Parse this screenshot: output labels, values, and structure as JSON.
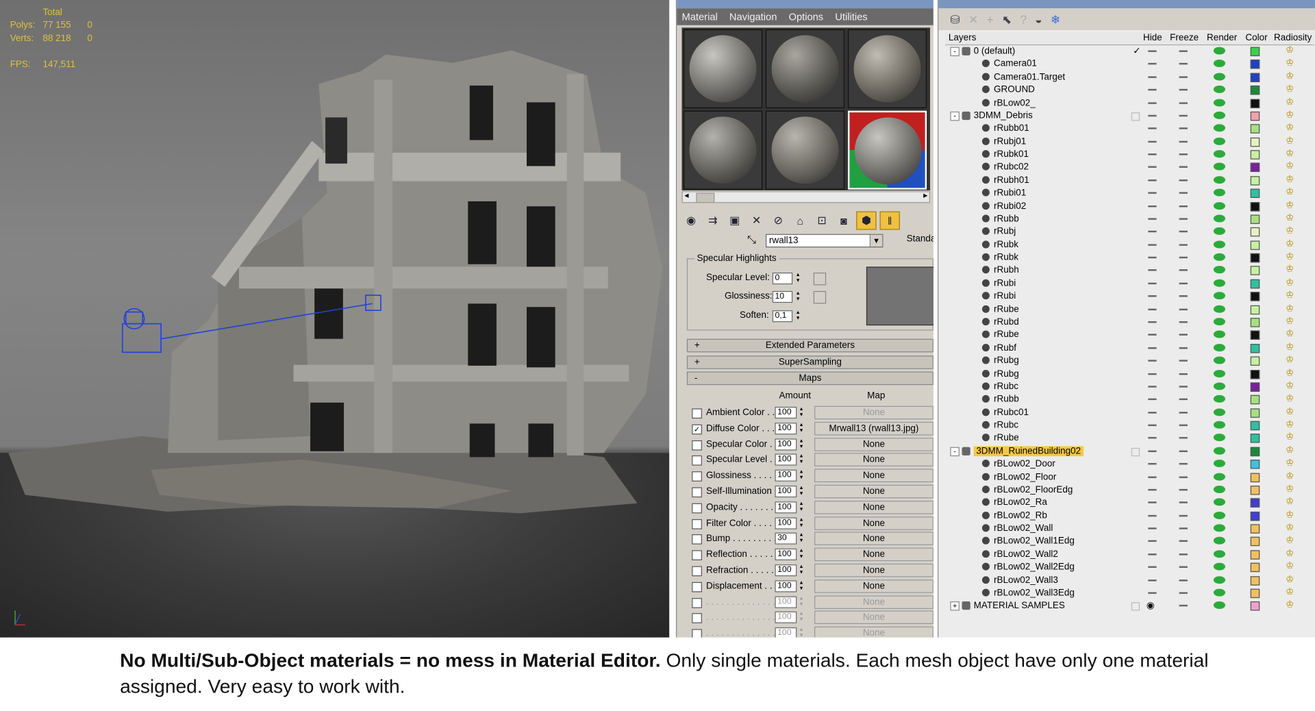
{
  "viewport": {
    "stats": {
      "total_label": "Total",
      "polys_label": "Polys:",
      "polys_value": "77 155",
      "polys_sel": "0",
      "verts_label": "Verts:",
      "verts_value": "88 218",
      "verts_sel": "0",
      "fps_label": "FPS:",
      "fps_value": "147,511"
    }
  },
  "material_editor": {
    "menu": [
      "Material",
      "Navigation",
      "Options",
      "Utilities"
    ],
    "material_name": "rwall13",
    "type_button": "Standa",
    "specular_group_label": "Specular Highlights",
    "specular_level_label": "Specular Level:",
    "specular_level_value": "0",
    "glossiness_label": "Glossiness:",
    "glossiness_value": "10",
    "soften_label": "Soften:",
    "soften_value": "0,1",
    "rollouts": [
      {
        "sign": "+",
        "label": "Extended Parameters"
      },
      {
        "sign": "+",
        "label": "SuperSampling"
      },
      {
        "sign": "-",
        "label": "Maps"
      }
    ],
    "maps_amount_header": "Amount",
    "maps_map_header": "Map",
    "maps": [
      {
        "checked": false,
        "label": "Ambient Color . .",
        "amount": "100",
        "map": "None",
        "disabled": false,
        "dim_map": true
      },
      {
        "checked": true,
        "label": "Diffuse Color . . .",
        "amount": "100",
        "map": "Mrwall13 (rwall13.jpg)",
        "disabled": false,
        "dim_map": false
      },
      {
        "checked": false,
        "label": "Specular Color . .",
        "amount": "100",
        "map": "None",
        "disabled": false,
        "dim_map": false
      },
      {
        "checked": false,
        "label": "Specular Level .",
        "amount": "100",
        "map": "None",
        "disabled": false,
        "dim_map": false
      },
      {
        "checked": false,
        "label": "Glossiness . . . . .",
        "amount": "100",
        "map": "None",
        "disabled": false,
        "dim_map": false
      },
      {
        "checked": false,
        "label": "Self-Illumination .",
        "amount": "100",
        "map": "None",
        "disabled": false,
        "dim_map": false
      },
      {
        "checked": false,
        "label": "Opacity . . . . . . . .",
        "amount": "100",
        "map": "None",
        "disabled": false,
        "dim_map": false
      },
      {
        "checked": false,
        "label": "Filter Color . . . . .",
        "amount": "100",
        "map": "None",
        "disabled": false,
        "dim_map": false
      },
      {
        "checked": false,
        "label": "Bump . . . . . . . . .",
        "amount": "30",
        "map": "None",
        "disabled": false,
        "dim_map": false
      },
      {
        "checked": false,
        "label": "Reflection . . . . .",
        "amount": "100",
        "map": "None",
        "disabled": false,
        "dim_map": false
      },
      {
        "checked": false,
        "label": "Refraction . . . . .",
        "amount": "100",
        "map": "None",
        "disabled": false,
        "dim_map": false
      },
      {
        "checked": false,
        "label": "Displacement . .",
        "amount": "100",
        "map": "None",
        "disabled": false,
        "dim_map": false
      },
      {
        "checked": false,
        "label": ". . . . . . . . . . . . . .",
        "amount": "100",
        "map": "None",
        "disabled": true,
        "dim_map": true
      },
      {
        "checked": false,
        "label": ". . . . . . . . . . . . . .",
        "amount": "100",
        "map": "None",
        "disabled": true,
        "dim_map": true
      },
      {
        "checked": false,
        "label": ". . . . . . . . . . . . . .",
        "amount": "100",
        "map": "None",
        "disabled": true,
        "dim_map": true
      }
    ]
  },
  "layer_panel": {
    "columns": {
      "layers": "Layers",
      "hide": "Hide",
      "freeze": "Freeze",
      "render": "Render",
      "color": "Color",
      "radiosity": "Radiosity"
    },
    "rows": [
      {
        "level": 0,
        "name": "0 (default)",
        "toggle": "-",
        "color": "#3cd04a",
        "active": true
      },
      {
        "level": 1,
        "name": "Camera01",
        "color": "#2040c8"
      },
      {
        "level": 1,
        "name": "Camera01.Target",
        "color": "#2040c8"
      },
      {
        "level": 1,
        "name": "GROUND",
        "color": "#1a8a3a"
      },
      {
        "level": 1,
        "name": "rBLow02_",
        "color": "#111111"
      },
      {
        "level": 0,
        "name": "3DMM_Debris",
        "toggle": "-",
        "color": "#f0a0b0",
        "box": true
      },
      {
        "level": 1,
        "name": "rRubb01",
        "color": "#a8e080"
      },
      {
        "level": 1,
        "name": "rRubj01",
        "color": "#e8f0c0"
      },
      {
        "level": 1,
        "name": "rRubk01",
        "color": "#c8f0a0"
      },
      {
        "level": 1,
        "name": "rRubc02",
        "color": "#7a20a0"
      },
      {
        "level": 1,
        "name": "rRubh01",
        "color": "#c8f0a0"
      },
      {
        "level": 1,
        "name": "rRubi01",
        "color": "#30c0a0"
      },
      {
        "level": 1,
        "name": "rRubi02",
        "color": "#111111"
      },
      {
        "level": 1,
        "name": "rRubb",
        "color": "#a8e080"
      },
      {
        "level": 1,
        "name": "rRubj",
        "color": "#e8f0c0"
      },
      {
        "level": 1,
        "name": "rRubk",
        "color": "#c8f0a0"
      },
      {
        "level": 1,
        "name": "rRubk",
        "color": "#111111"
      },
      {
        "level": 1,
        "name": "rRubh",
        "color": "#c8f0a0"
      },
      {
        "level": 1,
        "name": "rRubi",
        "color": "#30c0a0"
      },
      {
        "level": 1,
        "name": "rRubi",
        "color": "#111111"
      },
      {
        "level": 1,
        "name": "rRube",
        "color": "#c8f0a0"
      },
      {
        "level": 1,
        "name": "rRubd",
        "color": "#a8e080"
      },
      {
        "level": 1,
        "name": "rRube",
        "color": "#111111"
      },
      {
        "level": 1,
        "name": "rRubf",
        "color": "#30c0a0"
      },
      {
        "level": 1,
        "name": "rRubg",
        "color": "#c8f0a0"
      },
      {
        "level": 1,
        "name": "rRubg",
        "color": "#111111"
      },
      {
        "level": 1,
        "name": "rRubc",
        "color": "#7a20a0"
      },
      {
        "level": 1,
        "name": "rRubb",
        "color": "#a8e080"
      },
      {
        "level": 1,
        "name": "rRubc01",
        "color": "#a8e080"
      },
      {
        "level": 1,
        "name": "rRubc",
        "color": "#30c0a0"
      },
      {
        "level": 1,
        "name": "rRube",
        "color": "#30c0a0"
      },
      {
        "level": 0,
        "name": "3DMM_RuinedBuilding02",
        "toggle": "-",
        "color": "#1a8a3a",
        "highlight": true,
        "box": true
      },
      {
        "level": 1,
        "name": "rBLow02_Door",
        "color": "#40c0e0"
      },
      {
        "level": 1,
        "name": "rBLow02_Floor",
        "color": "#f0c060"
      },
      {
        "level": 1,
        "name": "rBLow02_FloorEdg",
        "color": "#f0c060"
      },
      {
        "level": 1,
        "name": "rBLow02_Ra",
        "color": "#4040d0"
      },
      {
        "level": 1,
        "name": "rBLow02_Rb",
        "color": "#4040d0"
      },
      {
        "level": 1,
        "name": "rBLow02_Wall",
        "color": "#f0c060"
      },
      {
        "level": 1,
        "name": "rBLow02_Wall1Edg",
        "color": "#f0c060"
      },
      {
        "level": 1,
        "name": "rBLow02_Wall2",
        "color": "#f0c060"
      },
      {
        "level": 1,
        "name": "rBLow02_Wall2Edg",
        "color": "#f0c060"
      },
      {
        "level": 1,
        "name": "rBLow02_Wall3",
        "color": "#f0c060"
      },
      {
        "level": 1,
        "name": "rBLow02_Wall3Edg",
        "color": "#f0c060"
      },
      {
        "level": 0,
        "name": "MATERIAL SAMPLES",
        "toggle": "+",
        "color": "#f0a0d0",
        "box": true,
        "hidden": true
      }
    ]
  },
  "caption": {
    "bold": "No Multi/Sub-Object materials = no mess in Material Editor.",
    "rest": " Only single materials. Each mesh object have only one material assigned. Very easy to work with."
  },
  "icons": [
    "camera-icon",
    "layer-icon",
    "render-teapot-icon",
    "radiosity-icon"
  ]
}
